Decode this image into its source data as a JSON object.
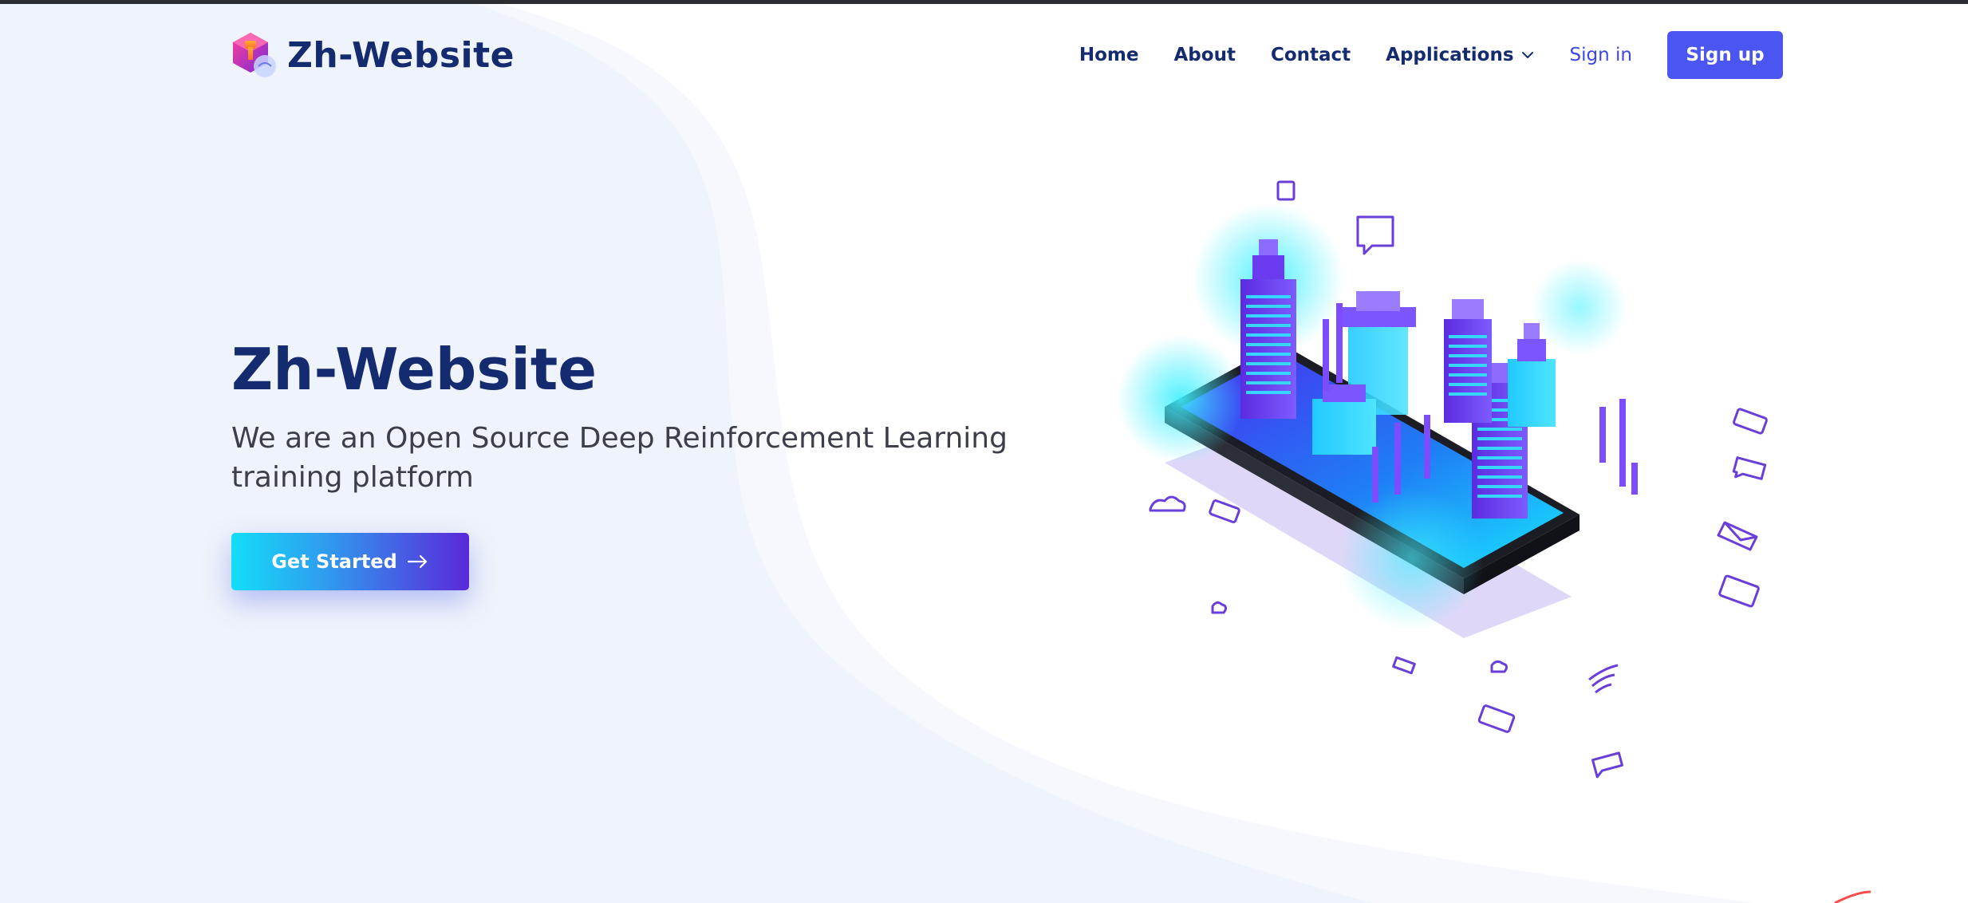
{
  "site": {
    "name": "Zh-Website"
  },
  "nav": {
    "home": "Home",
    "about": "About",
    "contact": "Contact",
    "applications": "Applications",
    "sign_in": "Sign in",
    "sign_up": "Sign up"
  },
  "hero": {
    "title": "Zh-Website",
    "subtitle": "We are an Open Source Deep Reinforcement Learning training platform",
    "cta_label": "Get Started"
  },
  "colors": {
    "brand_navy": "#142b6f",
    "accent_blue": "#4a55f2",
    "link_blue": "#3b47e8",
    "cta_gradient_start": "#13def8",
    "cta_gradient_end": "#5a28d9",
    "background_wave": "#eef2fa"
  },
  "icons": {
    "logo": "hexagon-cube-logo-icon",
    "applications_dropdown": "chevron-down-icon",
    "cta": "arrow-right-icon",
    "illustration": "isometric-smartphone-city-illustration"
  }
}
